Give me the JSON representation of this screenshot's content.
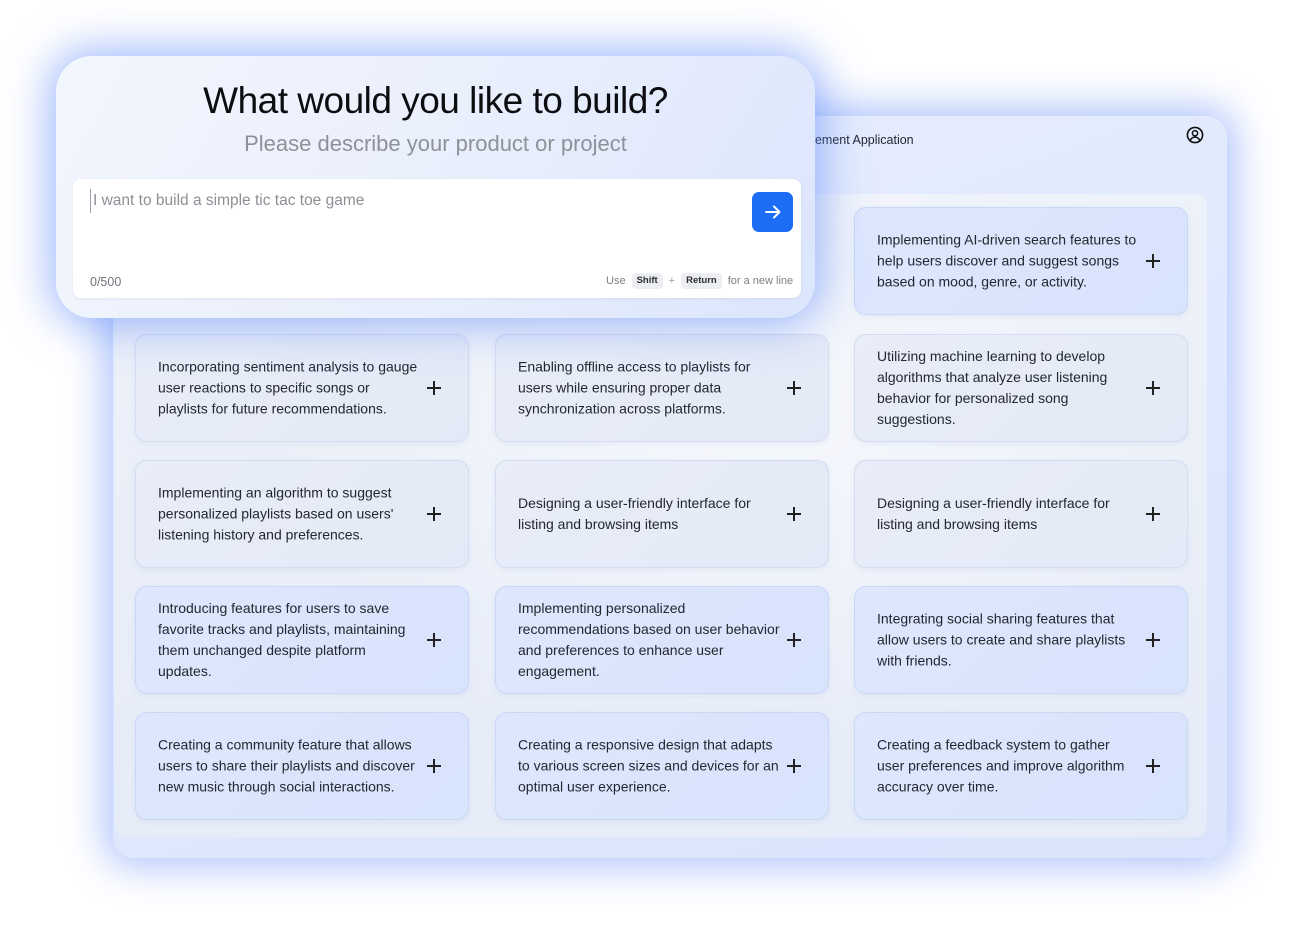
{
  "header": {
    "project_title": "gement Application"
  },
  "prompt": {
    "headline": "What would you like to build?",
    "subheadline": "Please describe your product or project",
    "input_placeholder": "I want to build a simple tic tac toe game",
    "input_value": "",
    "char_counter": "0/500",
    "hint_use": "Use",
    "hint_key1": "Shift",
    "hint_plus": "+",
    "hint_key2": "Return",
    "hint_suffix": "for a new line"
  },
  "suggestions": [
    {
      "text": "Implementing AI-driven search features to help users discover and suggest songs based on mood, genre, or activity."
    },
    {
      "text": "Incorporating sentiment analysis to gauge user reactions to specific songs or playlists for future recommendations."
    },
    {
      "text": "Enabling offline access to playlists for users while ensuring proper data synchronization across platforms."
    },
    {
      "text": "Utilizing machine learning to develop algorithms that analyze user listening behavior for personalized song suggestions."
    },
    {
      "text": "Implementing an algorithm to suggest personalized playlists based on users' listening history and preferences."
    },
    {
      "text": "Designing a user-friendly interface for listing and browsing items"
    },
    {
      "text": "Designing a user-friendly interface for listing and browsing items"
    },
    {
      "text": "Introducing features for users to save favorite tracks and playlists, maintaining them unchanged despite platform updates."
    },
    {
      "text": "Implementing personalized recommendations based on user behavior and preferences to enhance user engagement."
    },
    {
      "text": "Integrating social sharing features that allow users to create and share playlists with friends."
    },
    {
      "text": "Creating a community feature that allows users to share their playlists and discover new music through social interactions."
    },
    {
      "text": "Creating a responsive design that adapts to various screen sizes and devices for an optimal user experience."
    },
    {
      "text": "Creating a feedback system to gather user preferences and improve algorithm accuracy over time."
    }
  ],
  "icons": {
    "profile": "user-circle-icon",
    "add": "plus-icon",
    "submit": "arrow-right-icon"
  },
  "colors": {
    "accent": "#1c6cf4",
    "glow": "#5a87f7"
  }
}
